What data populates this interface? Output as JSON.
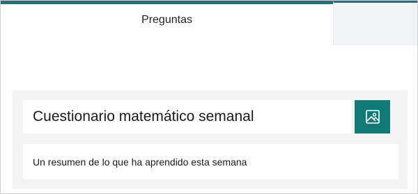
{
  "tabs": {
    "active_label": "Preguntas"
  },
  "form": {
    "title": "Cuestionario matemático semanal",
    "subtitle": "Un resumen de lo que ha aprendido esta semana",
    "image_button_icon": "image-icon"
  },
  "colors": {
    "accent": "#117a78",
    "card_background": "#f3f3f3"
  }
}
